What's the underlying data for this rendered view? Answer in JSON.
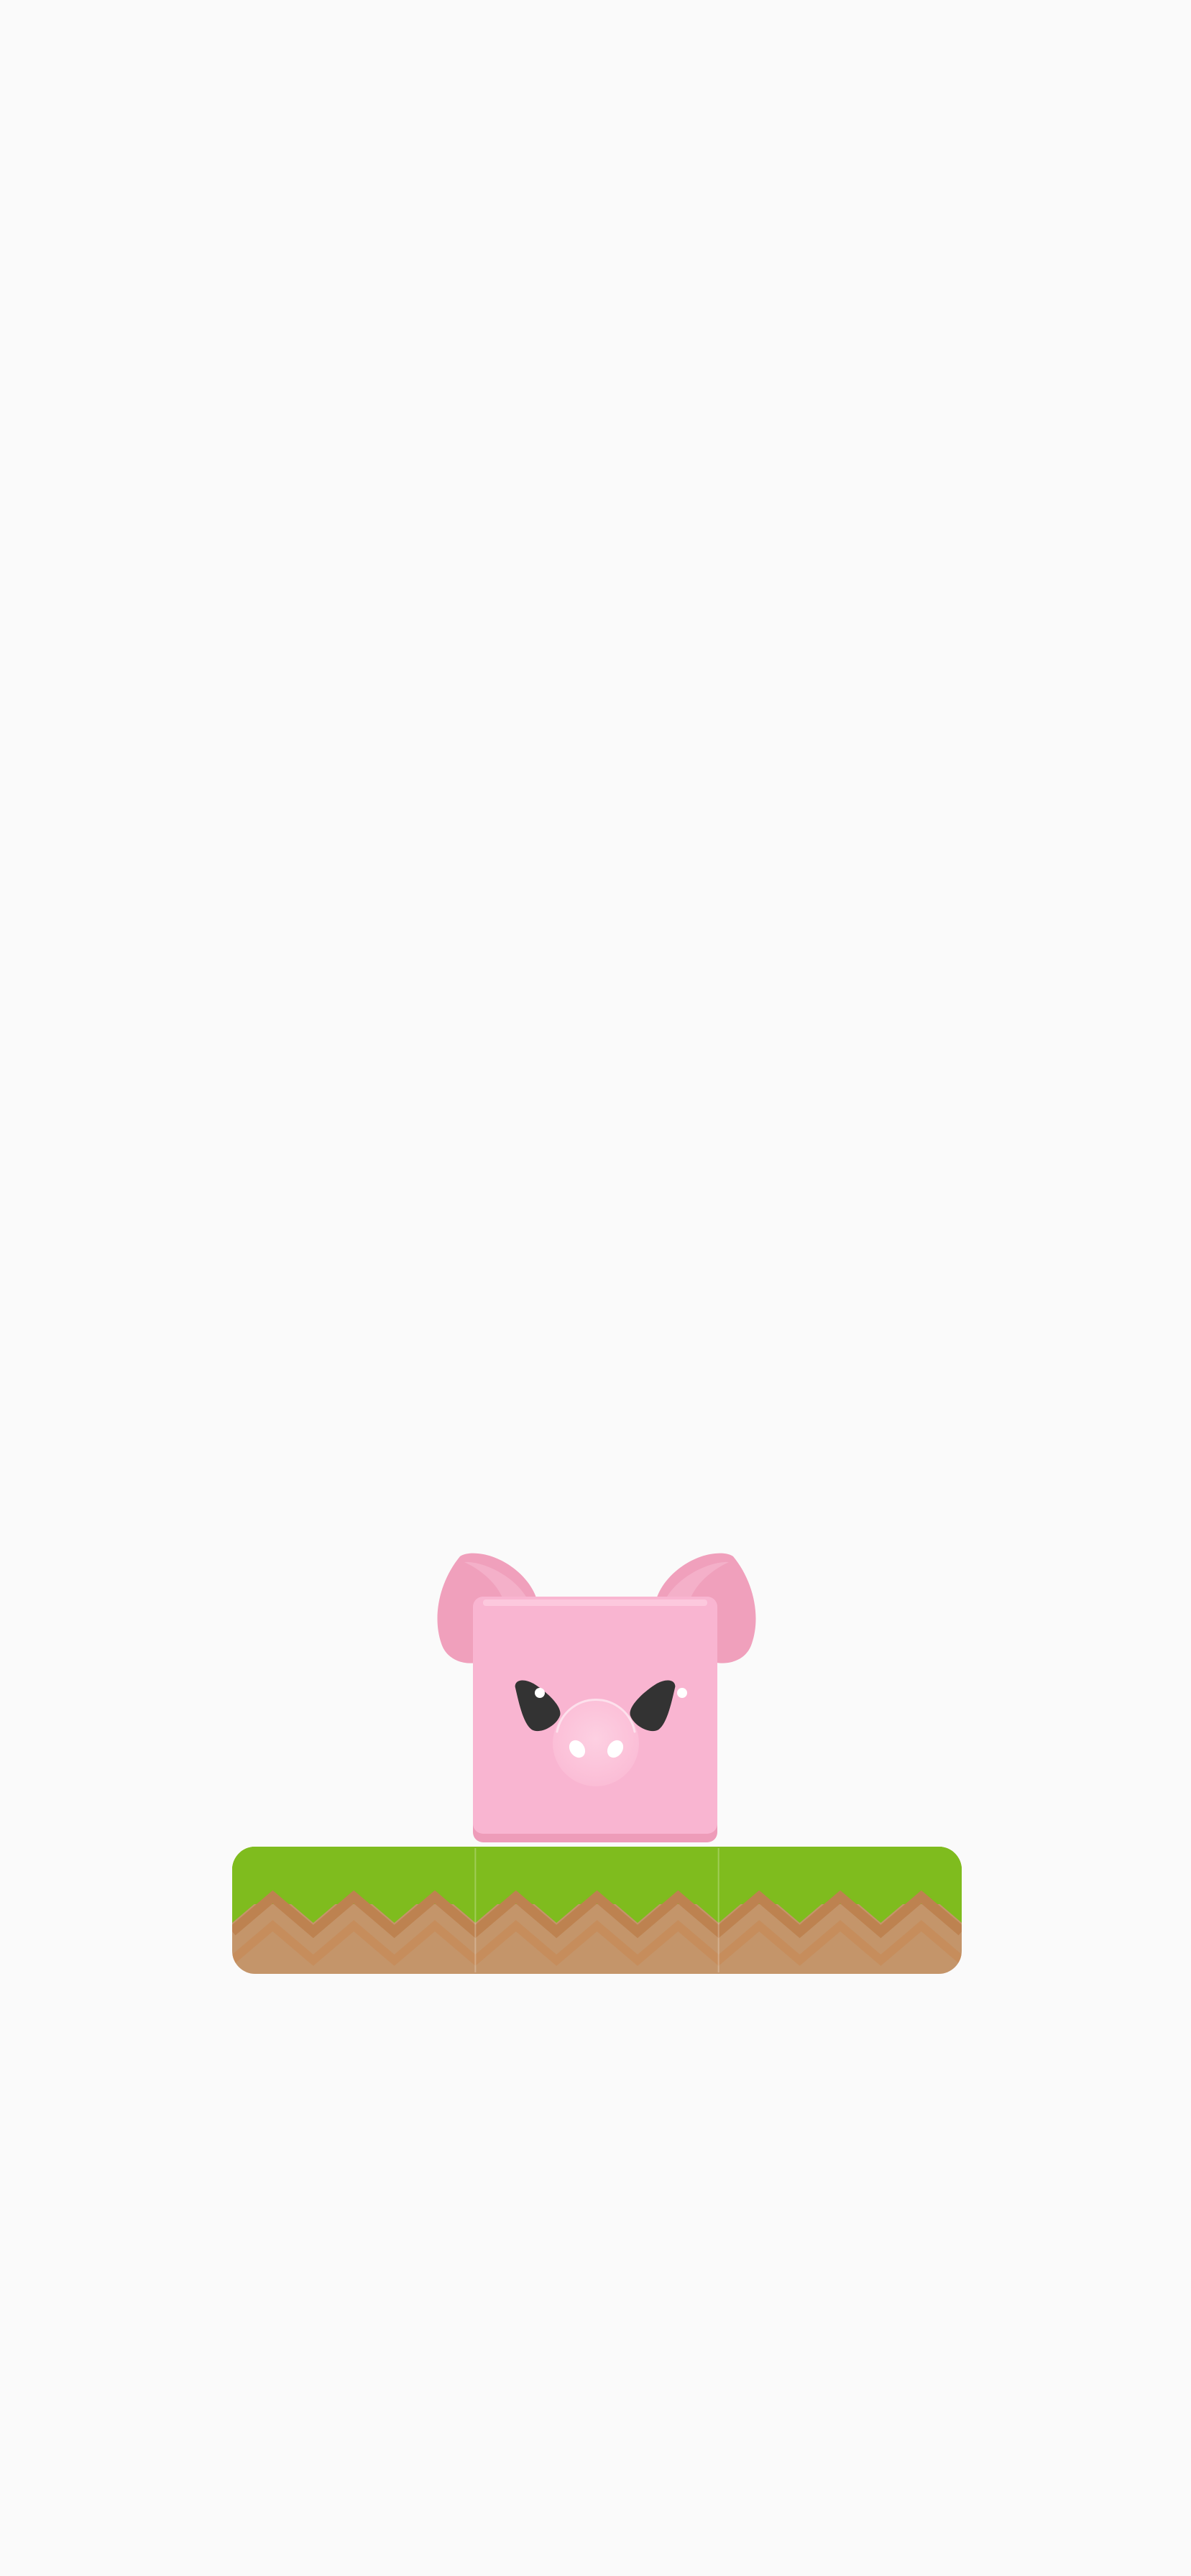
{
  "screen": {
    "background_color": "#fafafa"
  },
  "player": {
    "character": "pig",
    "body_color": "#f9b5d1",
    "ear_color": "#f0a0bc",
    "eye_color": "#333333",
    "snout_color": "#fbc4da"
  },
  "platform": {
    "segments": 3,
    "grass_color": "#7fbc1e",
    "dirt_color": "#c4956a",
    "zigzag_color": "#bd8250"
  }
}
